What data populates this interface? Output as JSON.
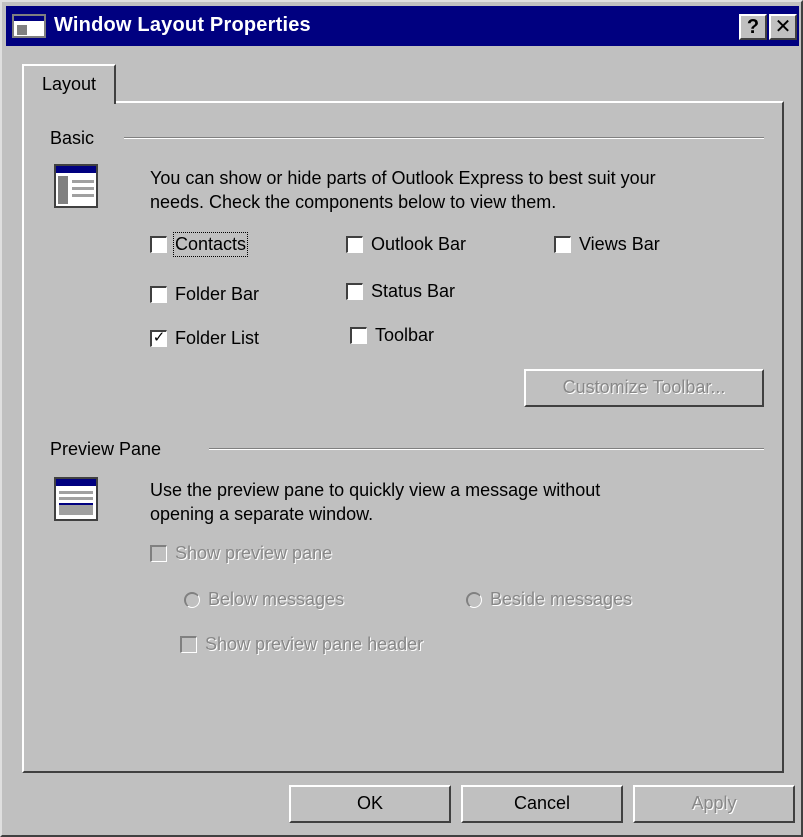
{
  "window": {
    "title": "Window Layout Properties",
    "help_label": "?",
    "close_label": "✕"
  },
  "tabs": [
    {
      "label": "Layout",
      "selected": true
    }
  ],
  "basic": {
    "title": "Basic",
    "icon": "window-layout-icon",
    "description_line1": "You can show or hide parts of Outlook Express to best suit your",
    "description_line2": "needs.  Check the components below to view them.",
    "options": [
      {
        "label": "Contacts",
        "checked": false
      },
      {
        "label": "Outlook Bar",
        "checked": false
      },
      {
        "label": "Views Bar",
        "checked": false
      },
      {
        "label": "Folder Bar",
        "checked": false
      },
      {
        "label": "Status Bar",
        "checked": false
      },
      {
        "label": "Folder List",
        "checked": true
      },
      {
        "label": "Toolbar",
        "checked": false
      }
    ],
    "customize_label": "Customize Toolbar..."
  },
  "preview": {
    "title": "Preview Pane",
    "icon": "preview-pane-icon",
    "description_line1": "Use the preview pane to quickly view a message without",
    "description_line2": "opening a separate window.",
    "show_preview_label": "Show preview pane",
    "below_label": "Below messages",
    "beside_label": "Beside messages",
    "show_header_label": "Show preview pane header"
  },
  "buttons": {
    "ok": "OK",
    "cancel": "Cancel",
    "apply": "Apply"
  },
  "check_mark": "✓"
}
